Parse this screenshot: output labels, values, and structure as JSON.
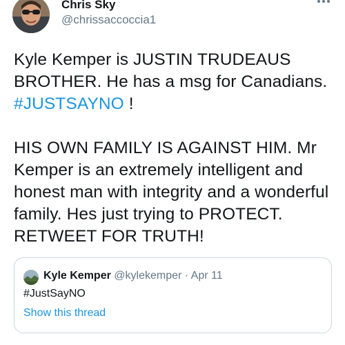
{
  "author": {
    "display_name": "Chris Sky",
    "handle": "@chrissaccoccia1",
    "avatar_icon": "profile-photo"
  },
  "more_icon": "more-horizontal-icon",
  "tweet": {
    "line1_before": "Kyle Kemper is JUSTIN TRUDEAUS BROTHER.  He has a msg for Canadians.  ",
    "hashtag": "#JUSTSAYNO",
    "line1_after": " !",
    "paragraph2": "HIS OWN FAMILY IS AGAINST HIM. Mr Kemper is an extremely intelligent and honest man with integrity and a wonderful family. Hes just trying to PROTECT.  RETWEET FOR TRUTH!"
  },
  "quote": {
    "display_name": "Kyle Kemper",
    "handle": "@kylekemper",
    "separator": "·",
    "date": "Apr 11",
    "text": "#JustSayNO",
    "show_thread": "Show this thread"
  },
  "colors": {
    "link": "#1b95e0",
    "secondary_text": "#657786",
    "border": "#ccd6dd",
    "primary_text": "#14171a"
  }
}
